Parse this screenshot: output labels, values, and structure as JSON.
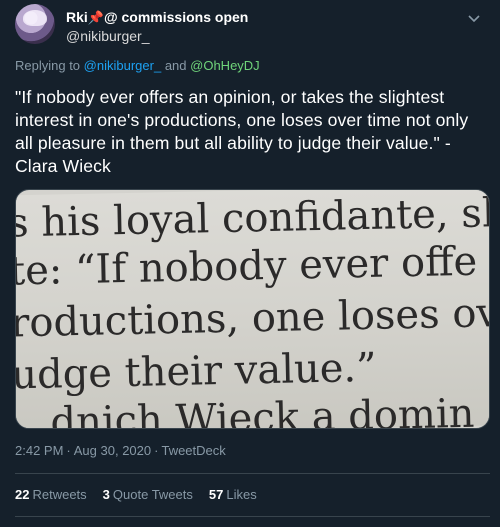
{
  "author": {
    "display_name": "Rki",
    "display_badge": "@ commissions open",
    "handle": "@nikiburger_",
    "pin_icon": "pushpin"
  },
  "replying": {
    "prefix": "Replying to",
    "mention_one": "@nikiburger_",
    "joiner": "and",
    "mention_two": "@OhHeyDJ"
  },
  "tweet": {
    "text": "\"If nobody ever offers an opinion, or takes the slightest interest in one's productions, one loses over time not only all pleasure in them but all ability to judge their value.\" - Clara Wieck"
  },
  "media": {
    "lines": [
      "s his loyal confidante, she",
      "te: “If nobody ever offe",
      "roductions, one loses ov",
      "udge their value.”",
      "...dnich Wieck   a domin"
    ]
  },
  "meta": {
    "time": "2:42 PM",
    "date": "Aug 30, 2020",
    "source": "TweetDeck",
    "separator": "·"
  },
  "stats": {
    "retweets_count": "22",
    "retweets_label": "Retweets",
    "quotes_count": "3",
    "quotes_label": "Quote Tweets",
    "likes_count": "57",
    "likes_label": "Likes"
  },
  "colors": {
    "background": "#15202b",
    "accent": "#1da1f2",
    "secondary_text": "#8899a6",
    "border": "#38444d"
  }
}
